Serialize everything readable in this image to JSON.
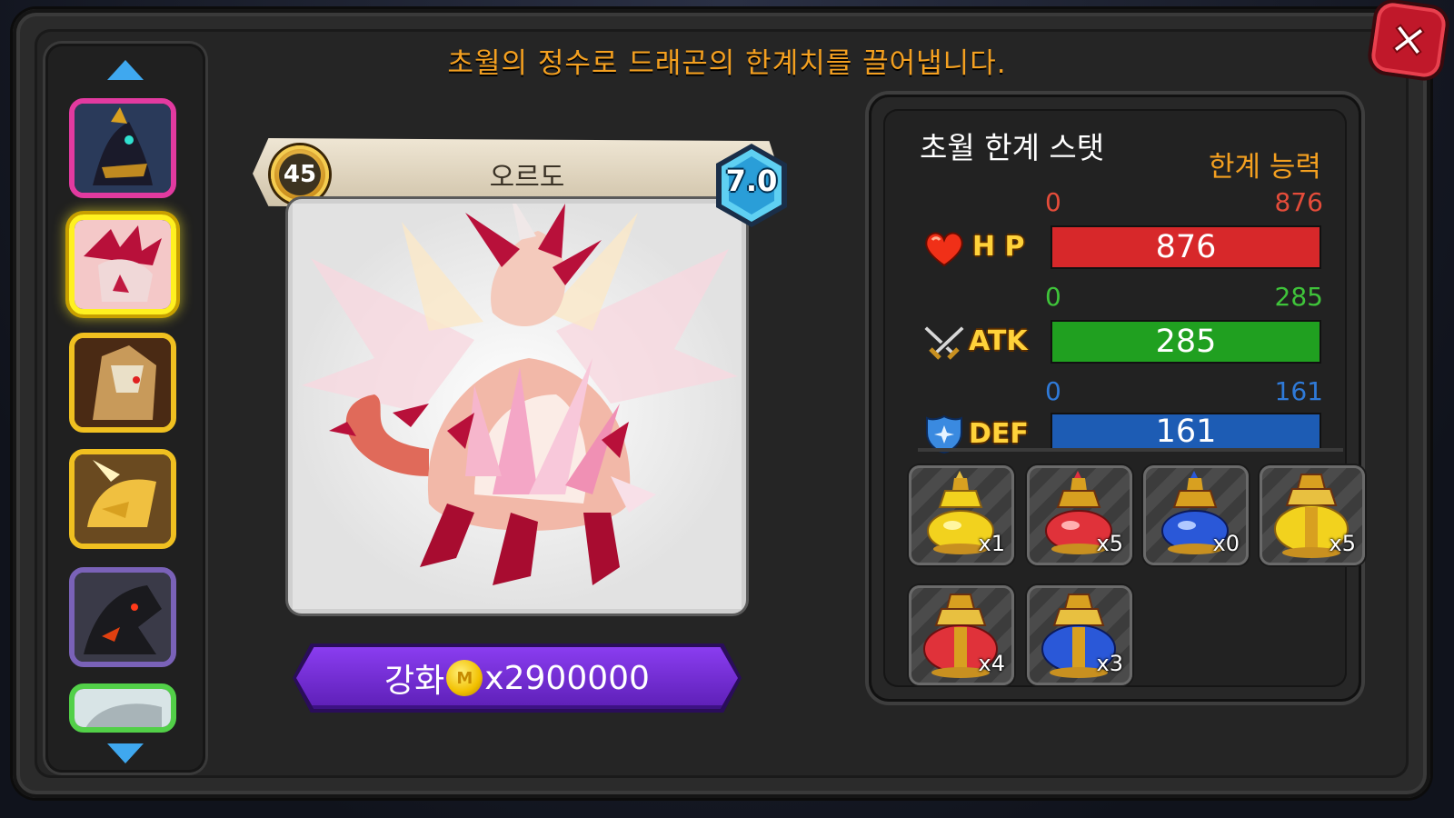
{
  "header": {
    "message": "초월의 정수로 드래곤의 한계치를 끌어냅니다."
  },
  "dragon": {
    "level": "45",
    "name": "오르도",
    "grade": "7.0"
  },
  "upgrade": {
    "label": "강화",
    "coin_symbol": "M",
    "cost": "x2900000"
  },
  "stats_panel": {
    "title": "초월 한계 스탯",
    "limit_label": "한계 능력",
    "stats": [
      {
        "name": "H P",
        "min": "0",
        "max": "876",
        "value": "876",
        "fill": 1.0,
        "color": "#d7282a",
        "label_color": "#e54c3a",
        "icon": "heart-icon"
      },
      {
        "name": "ATK",
        "min": "0",
        "max": "285",
        "value": "285",
        "fill": 1.0,
        "color": "#20a020",
        "label_color": "#3fc43a",
        "icon": "crossed-swords-icon"
      },
      {
        "name": "DEF",
        "min": "0",
        "max": "161",
        "value": "161",
        "fill": 1.0,
        "color": "#1d5cb4",
        "label_color": "#2f7ad8",
        "icon": "shield-icon"
      }
    ]
  },
  "items": [
    {
      "name": "yellow-potion",
      "count": "x1",
      "color": "#f2d21e"
    },
    {
      "name": "red-potion",
      "count": "x5",
      "color": "#e0323a"
    },
    {
      "name": "blue-potion",
      "count": "x0",
      "color": "#2a58d8"
    },
    {
      "name": "large-yellow-potion",
      "count": "x5",
      "color": "#f2d21e"
    },
    {
      "name": "large-red-potion",
      "count": "x4",
      "color": "#e0323a"
    },
    {
      "name": "large-blue-potion",
      "count": "x3",
      "color": "#2a58d8"
    }
  ],
  "dragon_list": [
    {
      "name": "dark-armored-dragon",
      "frame": "pink"
    },
    {
      "name": "crimson-crystal-dragon",
      "frame": "selected"
    },
    {
      "name": "golden-armored-dragon",
      "frame": "gold"
    },
    {
      "name": "golden-horned-dragon",
      "frame": "gold"
    },
    {
      "name": "shadow-dragon",
      "frame": "purple"
    },
    {
      "name": "silver-dragon",
      "frame": "green"
    }
  ]
}
